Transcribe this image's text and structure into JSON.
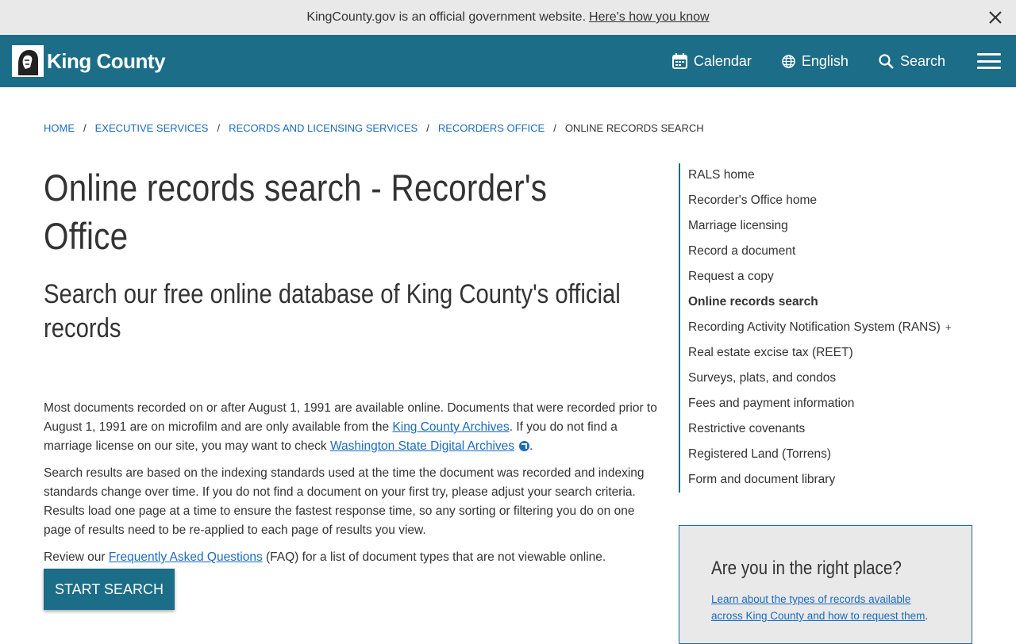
{
  "gov_banner": {
    "text": "KingCounty.gov is an official government website.",
    "link": "Here's how you know"
  },
  "header": {
    "logo_text": "King County",
    "nav": {
      "calendar": "Calendar",
      "language": "English",
      "search": "Search"
    }
  },
  "breadcrumb": [
    "HOME",
    "EXECUTIVE SERVICES",
    "RECORDS AND LICENSING SERVICES",
    "RECORDERS OFFICE",
    "ONLINE RECORDS SEARCH"
  ],
  "main": {
    "title": "Online records search - Recorder's Office",
    "subtitle": "Search our free online database of King County's official records",
    "p1_a": "Most documents recorded on or after August 1, 1991 are available online. Documents that were recorded prior to August 1, 1991 are on microfilm and are only available from the ",
    "p1_link1": "King County Archives",
    "p1_b": ". If you do not find a marriage license on our site, you may want to check ",
    "p1_link2": "Washington State Digital Archives",
    "p1_c": ".",
    "p2": "Search results are based on the indexing standards used at the time the document was recorded and indexing standards change over time. If you do not find a document on your first try, please adjust your search criteria. Results load one page at a time to ensure the fastest response time, so any sorting or filtering you do on one page of results need to be re-applied to each page of results you view.",
    "p3_a": "Review our ",
    "p3_link": "Frequently Asked Questions",
    "p3_b": " (FAQ) for a list of document types that are not viewable online.",
    "button": "START SEARCH"
  },
  "side_nav": {
    "items": [
      {
        "label": "RALS home"
      },
      {
        "label": "Recorder's Office home"
      },
      {
        "label": "Marriage licensing"
      },
      {
        "label": "Record a document"
      },
      {
        "label": "Request a copy"
      },
      {
        "label": "Online records search",
        "active": true
      },
      {
        "label": "Recording Activity Notification System (RANS)",
        "expand": "+"
      },
      {
        "label": "Real estate excise tax (REET)"
      },
      {
        "label": "Surveys, plats, and condos"
      },
      {
        "label": "Fees and payment information"
      },
      {
        "label": "Restrictive covenants"
      },
      {
        "label": "Registered Land (Torrens)"
      },
      {
        "label": "Form and document library"
      }
    ]
  },
  "callout": {
    "title": "Are you in the right place?",
    "link": "Learn about the types of records available across King County and how to request them",
    "link_tail": "."
  },
  "colors": {
    "brand": "#1c6d87",
    "link": "#1a6bbf",
    "banner_bg": "#e9e9e9"
  }
}
